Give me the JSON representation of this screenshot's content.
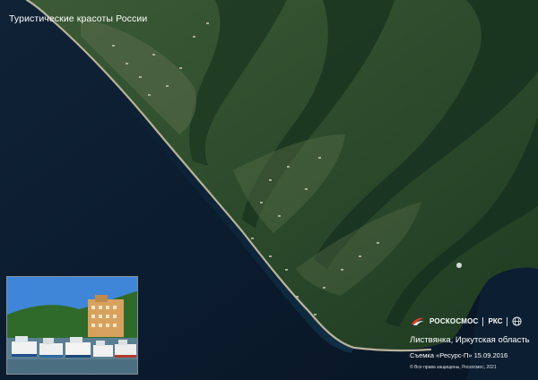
{
  "header": {
    "title": "Туристические красоты России"
  },
  "branding": {
    "logo_icon": "roscosmos-logo-icon",
    "agency": "РОСКОСМОС",
    "division": "РКС",
    "emblem_icon": "globe-emblem-icon"
  },
  "caption": {
    "location": "Листвянка, Иркутская область",
    "capture": "Съемка «Ресурс-П» 15.09.2016",
    "rights": "© Все права защищены, Роскосмос, 2021"
  },
  "colors": {
    "lake": "#0b1b2e",
    "forest": "#274a2b",
    "shore": "#c8c0a8",
    "text": "#ffffff"
  }
}
